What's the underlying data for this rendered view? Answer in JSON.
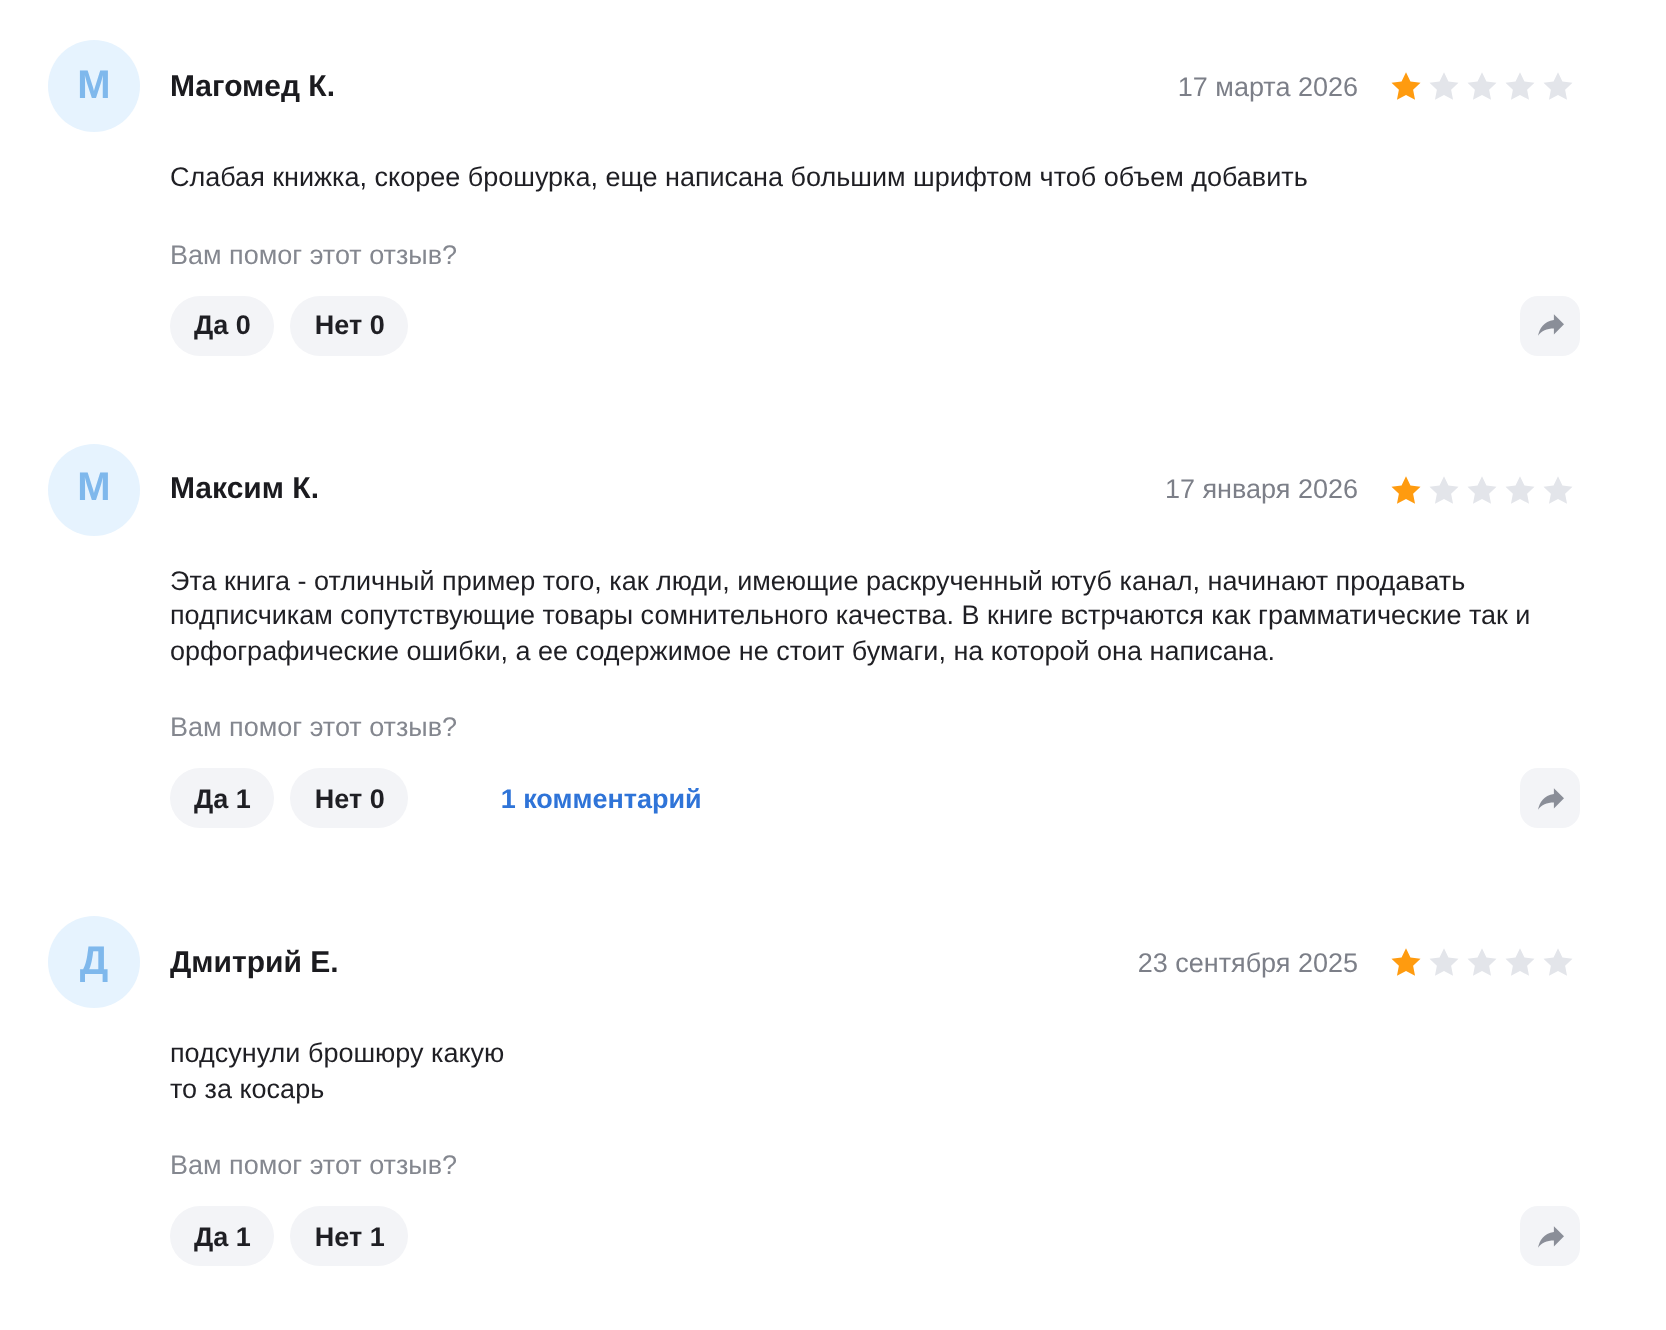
{
  "reviews": [
    {
      "initial": "М",
      "author": "Магомед К.",
      "date": "17 марта 2026",
      "stars": 1,
      "text": "Слабая книжка, скорее брошурка, еще написана большим шрифтом чтоб объем добавить",
      "helpful_question": "Вам помог этот отзыв?",
      "votes": [
        "Да 0",
        "Нет 0"
      ]
    },
    {
      "initial": "М",
      "author": "Максим К.",
      "date": "17 января 2026",
      "stars": 1,
      "text": "Эта книга - отличный пример того, как люди, имеющие раскрученный ютуб канал, начинают продавать подписчикам сопутствующие товары сомнительного качества. В книге встрчаются как грамматические так и орфографические ошибки, а ее содержимое не стоит бумаги, на которой она написана.",
      "helpful_question": "Вам помог этот отзыв?",
      "votes": [
        "Да 1",
        "Нет 0"
      ],
      "comments_link": "1 комментарий"
    },
    {
      "initial": "Д",
      "author": "Дмитрий Е.",
      "date": "23 сентября 2025",
      "stars": 1,
      "text": "подсунули брошюру какую\nто за косарь",
      "helpful_question": "Вам помог этот отзыв?",
      "votes": [
        "Да 1",
        "Нет 1"
      ]
    }
  ]
}
